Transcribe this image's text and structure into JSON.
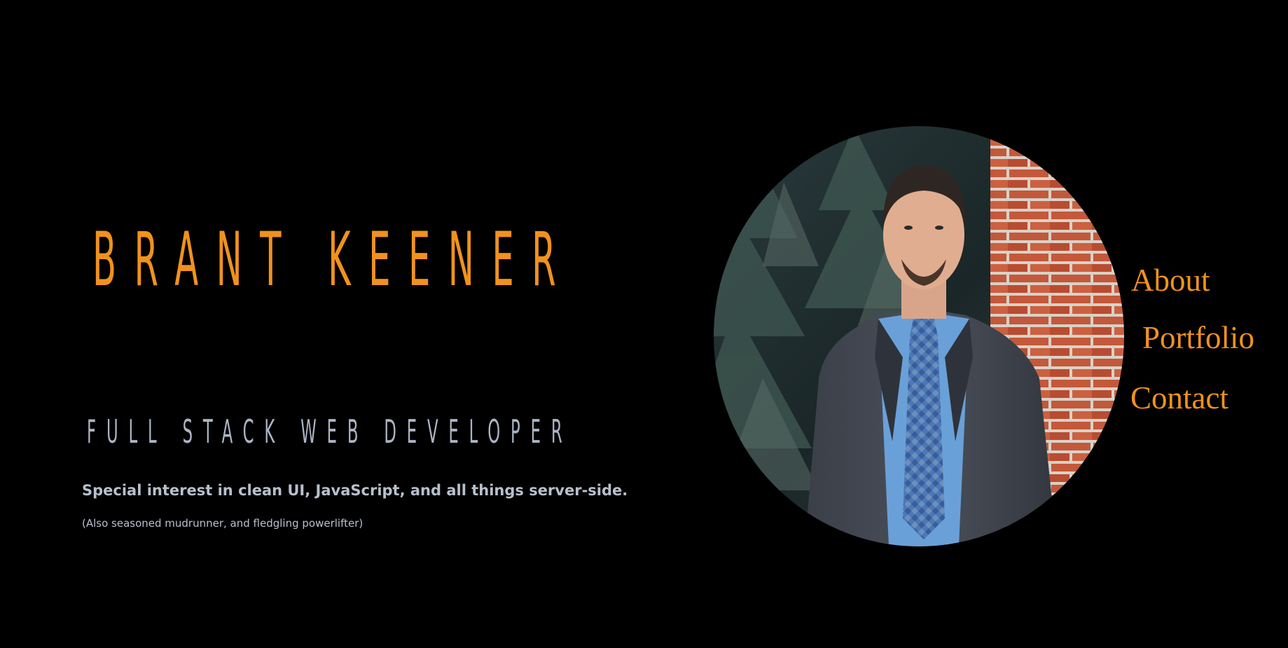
{
  "hero": {
    "name": "BRANT KEENER",
    "title": "FULL STACK WEB DEVELOPER",
    "tagline": "Special interest in clean UI, JavaScript, and all things server-side.",
    "note": "(Also seasoned mudrunner, and fledgling powerlifter)"
  },
  "nav": {
    "items": [
      {
        "label": "About"
      },
      {
        "label": "Portfolio"
      },
      {
        "label": "Contact"
      }
    ]
  },
  "portrait": {
    "alt": "Brant Keener portrait"
  },
  "colors": {
    "background": "#000000",
    "accent": "#f0921d",
    "text_muted": "#b7c0cd"
  }
}
